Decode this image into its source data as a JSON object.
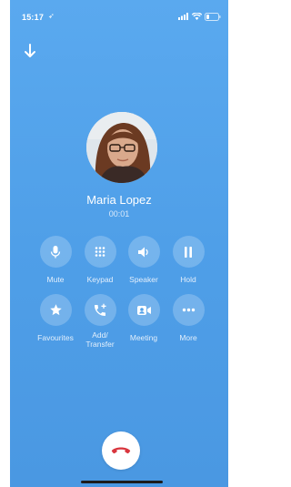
{
  "status_bar": {
    "time": "15:17",
    "location_glyph": "➶",
    "icons": [
      "signal-icon",
      "wifi-icon",
      "battery-icon"
    ]
  },
  "call": {
    "caller_name": "Maria Lopez",
    "duration": "00:01"
  },
  "actions_row1": [
    {
      "label": "Mute",
      "icon": "microphone-icon"
    },
    {
      "label": "Keypad",
      "icon": "keypad-icon"
    },
    {
      "label": "Speaker",
      "icon": "speaker-icon"
    },
    {
      "label": "Hold",
      "icon": "pause-icon"
    }
  ],
  "actions_row2": [
    {
      "label": "Favourites",
      "icon": "star-icon"
    },
    {
      "label": "Add/\nTransfer",
      "icon": "add-call-icon"
    },
    {
      "label": "Meeting",
      "icon": "video-meeting-icon"
    },
    {
      "label": "More",
      "icon": "more-icon"
    }
  ],
  "colors": {
    "background": "#4f9fe8",
    "end_call_icon": "#d9363e",
    "button_fill": "rgba(255,255,255,0.22)"
  }
}
